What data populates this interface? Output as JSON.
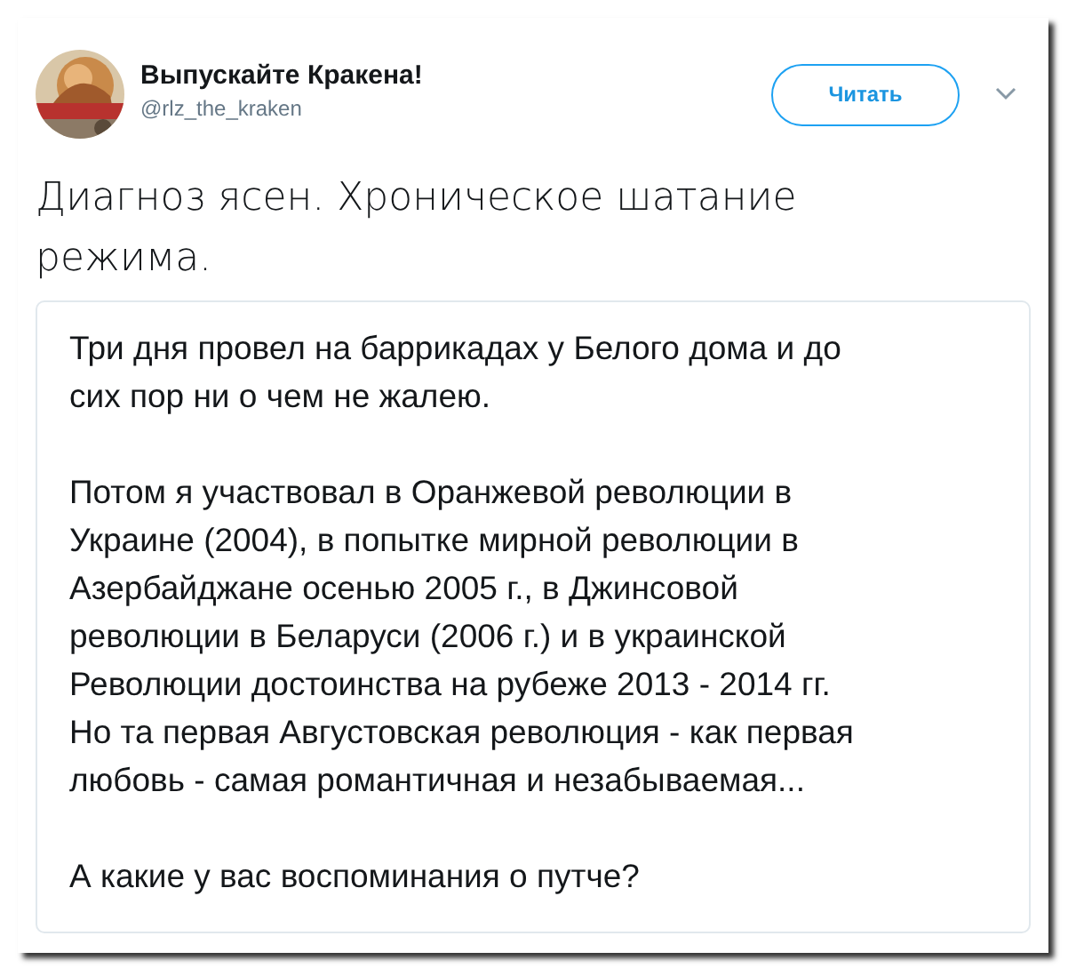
{
  "tweet": {
    "author_name": "Выпускайте Кракена!",
    "handle": "@rlz_the_kraken",
    "follow_button": "Читать",
    "text_lines": [
      "Диагноз ясен. Хроническое шатание",
      "режима."
    ]
  },
  "quoted_text": {
    "paragraphs": [
      {
        "lines": [
          "Три дня провел на баррикадах у Белого дома и до",
          "сих пор ни о чем не жалею."
        ]
      },
      {
        "lines": [
          "Потом я участвовал в Оранжевой революции в",
          "Украине (2004), в попытке мирной революции в",
          "Азербайджане осенью 2005 г., в Джинсовой",
          "революции в Беларуси (2006 г.) и в украинской",
          "Революции достоинства на рубеже 2013 - 2014 гг.",
          "Но та первая Августовская революция - как первая",
          "любовь - самая романтичная и незабываемая..."
        ]
      },
      {
        "lines": [
          "А какие у вас воспоминания о путче?"
        ]
      }
    ]
  }
}
